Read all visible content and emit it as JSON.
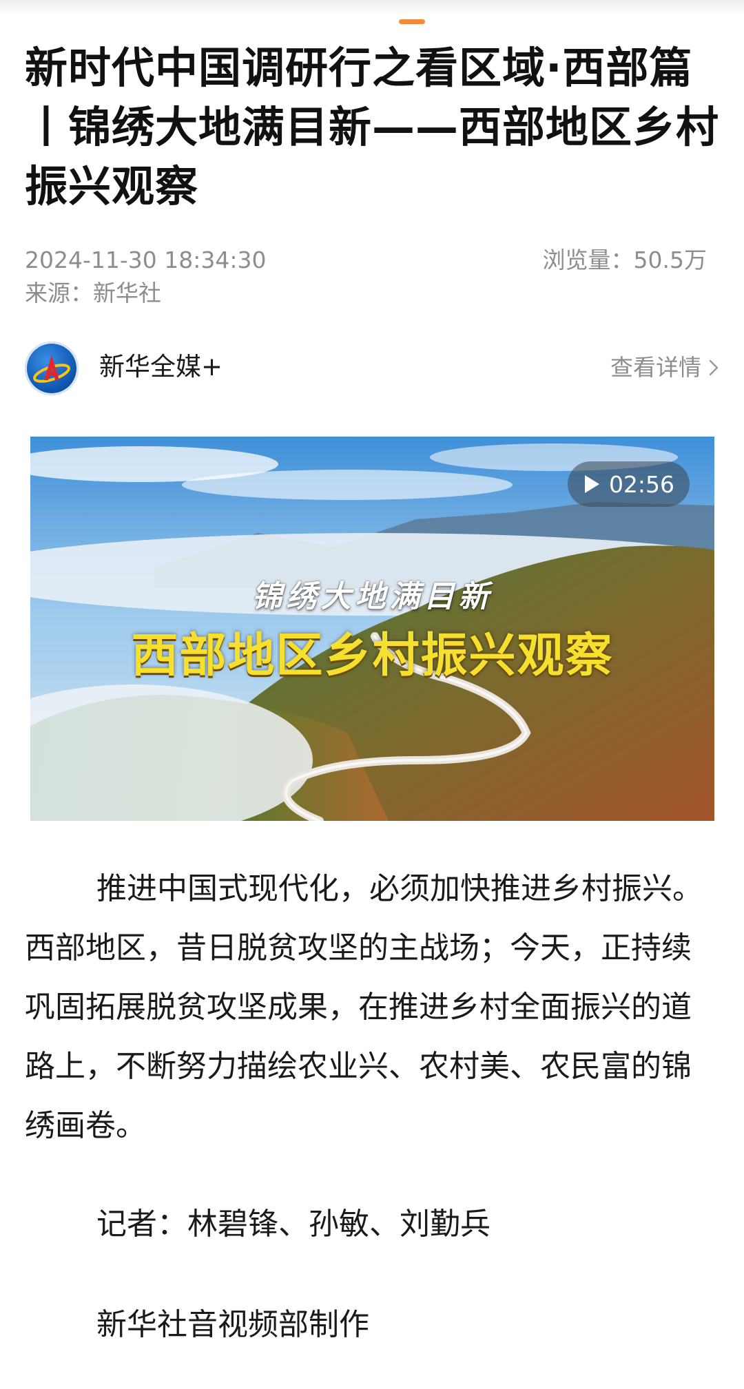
{
  "article": {
    "title": "新时代中国调研行之看区域·西部篇丨锦绣大地满目新——西部地区乡村振兴观察",
    "date": "2024-11-30 18:34:30",
    "source": "来源：新华社",
    "views": "浏览量：50.5万"
  },
  "author": {
    "name": "新华全媒+",
    "detail_link": "查看详情"
  },
  "video": {
    "duration": "02:56",
    "overlay_subtitle": "锦绣大地满目新",
    "overlay_title": "西部地区乡村振兴观察"
  },
  "body": {
    "paragraph": "推进中国式现代化，必须加快推进乡村振兴。西部地区，昔日脱贫攻坚的主战场；今天，正持续巩固拓展脱贫攻坚成果，在推进乡村全面振兴的道路上，不断努力描绘农业兴、农村美、农民富的锦绣画卷。",
    "reporters": "记者：林碧锋、孙敏、刘勤兵",
    "production": "新华社音视频部制作"
  },
  "colors": {
    "accent_handle": "#f28a3c",
    "meta_gray": "#8d8d8d",
    "overlay_yellow": "#f6df2d"
  },
  "icons": {
    "avatar": "xinhua-logo-icon",
    "detail": "chevron-right-icon",
    "play": "play-icon"
  }
}
